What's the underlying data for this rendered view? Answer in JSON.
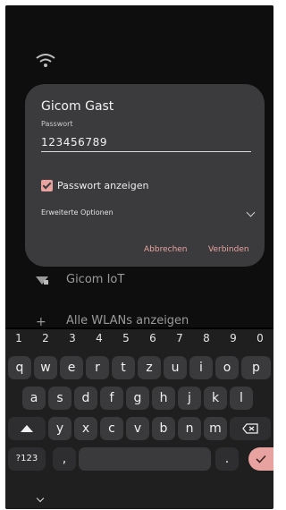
{
  "background": {
    "networks": [
      {
        "label": "Gicom IoT",
        "icon": "wifi-lock-icon"
      },
      {
        "label": "Alle WLANs anzeigen",
        "icon": "plus-icon"
      }
    ]
  },
  "dialog": {
    "title": "Gicom Gast",
    "password_label": "Passwort",
    "password_value": "123456789",
    "show_password_label": "Passwort anzeigen",
    "show_password_checked": true,
    "advanced_options_label": "Erweiterte Optionen",
    "cancel_label": "Abbrechen",
    "connect_label": "Verbinden",
    "accent_color": "#e8a3a0"
  },
  "keyboard": {
    "number_row": [
      "1",
      "2",
      "3",
      "4",
      "5",
      "6",
      "7",
      "8",
      "9",
      "0"
    ],
    "row1": [
      "q",
      "w",
      "e",
      "r",
      "t",
      "z",
      "u",
      "i",
      "o",
      "p"
    ],
    "row2": [
      "a",
      "s",
      "d",
      "f",
      "g",
      "h",
      "j",
      "k",
      "l"
    ],
    "row3": [
      "y",
      "x",
      "c",
      "v",
      "b",
      "n",
      "m"
    ],
    "symbols_label": "?123",
    "comma_label": ",",
    "period_label": "."
  }
}
